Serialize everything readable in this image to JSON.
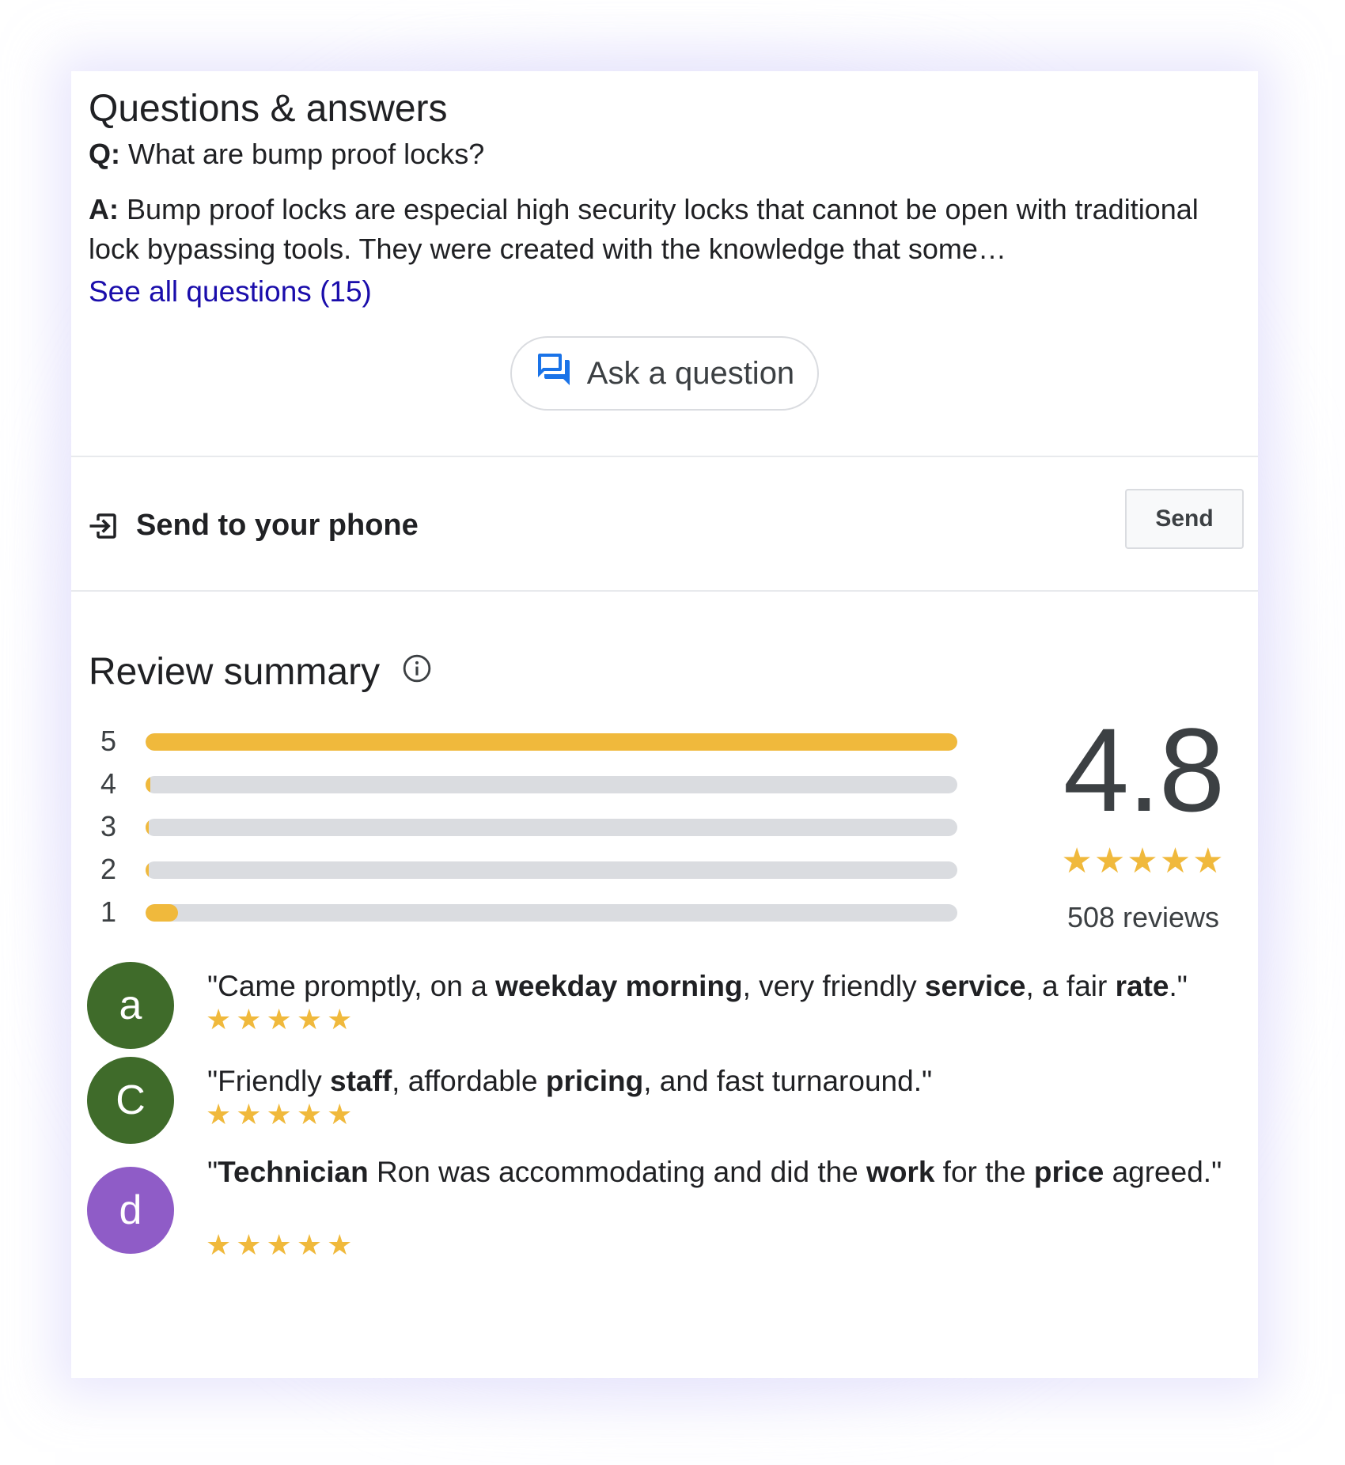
{
  "qa": {
    "title": "Questions & answers",
    "question_prefix": "Q:",
    "question": " What are bump proof locks?",
    "answer_prefix": "A:",
    "answer": " Bump proof locks are especial high security locks that cannot be open with traditional lock bypassing tools. They were created with the knowledge that some…",
    "see_all": "See all questions (15)",
    "ask_button": "Ask a question"
  },
  "send": {
    "label": "Send to your phone",
    "button": "Send"
  },
  "review_summary": {
    "title": "Review summary",
    "rating": "4.8",
    "stars": "★★★★★",
    "count": "508 reviews",
    "distribution": [
      {
        "stars": "5",
        "fraction": 1.0
      },
      {
        "stars": "4",
        "fraction": 0.006
      },
      {
        "stars": "3",
        "fraction": 0.004
      },
      {
        "stars": "2",
        "fraction": 0.004
      },
      {
        "stars": "1",
        "fraction": 0.04
      }
    ]
  },
  "snippets": [
    {
      "avatar_letter": "a",
      "avatar_color": "#3f6b2a",
      "parts": [
        "\"Came promptly, on a ",
        "weekday morning",
        ", very friendly ",
        "service",
        ", a fair ",
        "rate",
        ".\""
      ],
      "stars": "★★★★★"
    },
    {
      "avatar_letter": "C",
      "avatar_color": "#3f6b2a",
      "parts": [
        "\"Friendly ",
        "staff",
        ", affordable ",
        "pricing",
        ", and fast turnaround.\""
      ],
      "stars": "★★★★★"
    },
    {
      "avatar_letter": "d",
      "avatar_color": "#8f5cc7",
      "parts": [
        "\"",
        "Technician",
        " Ron was accommodating and did the ",
        "work",
        " for the ",
        "price",
        " agreed.\""
      ],
      "stars": "★★★★★"
    }
  ],
  "colors": {
    "link": "#1a0dab",
    "star": "#f0b93c",
    "bar_track": "#dadce0",
    "accent_icon": "#1a73e8"
  }
}
